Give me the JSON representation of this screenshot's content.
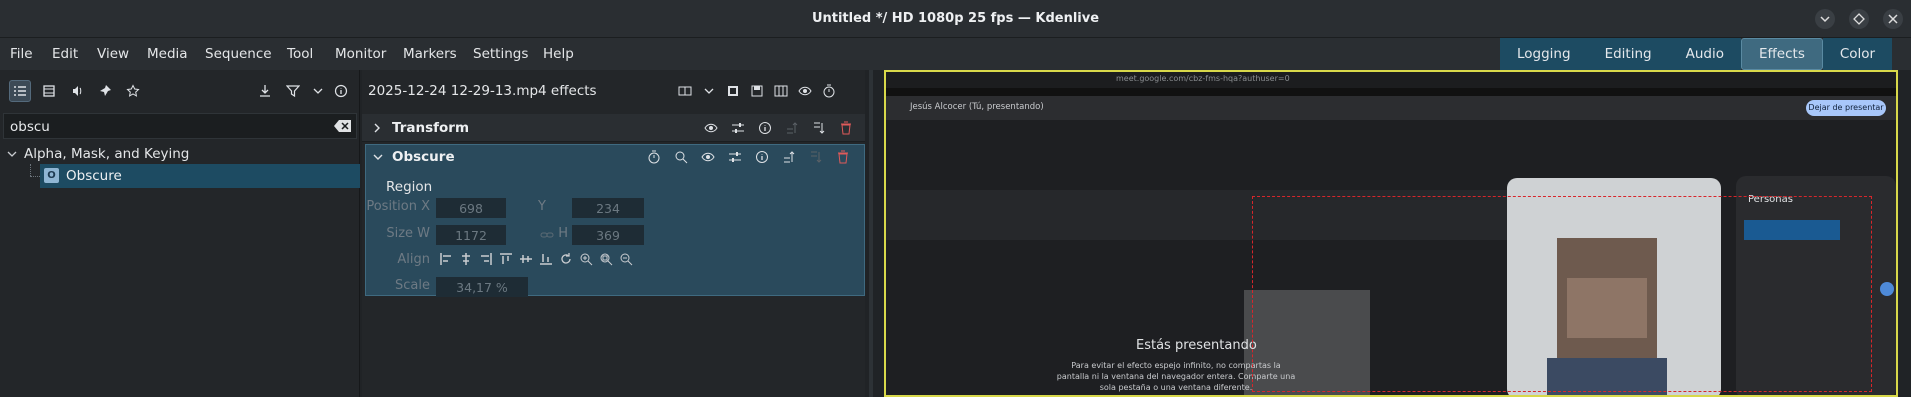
{
  "window": {
    "title": "Untitled */ HD 1080p 25 fps — Kdenlive",
    "controls": [
      "chevron-down-icon",
      "restore-icon",
      "close-icon"
    ]
  },
  "menu": {
    "items": [
      "File",
      "Edit",
      "View",
      "Media",
      "Sequence",
      "Tool",
      "Monitor",
      "Markers",
      "Settings",
      "Help"
    ]
  },
  "layouts": {
    "tabs": [
      "Logging",
      "Editing",
      "Audio",
      "Effects",
      "Color"
    ],
    "active": "Effects"
  },
  "effects_browser": {
    "search_value": "obscu",
    "category": "Alpha, Mask, and Keying",
    "item": "Obscure"
  },
  "effect_stack": {
    "title": "2025-12-24 12-29-13.mp4 effects",
    "effects": [
      {
        "name": "Transform",
        "expanded": false
      },
      {
        "name": "Obscure",
        "expanded": true
      }
    ],
    "obscure": {
      "region_label": "Region",
      "position_x_label": "Position X",
      "position_x": "698",
      "y_label": "Y",
      "y": "234",
      "size_w_label": "Size W",
      "size_w": "1172",
      "h_label": "H",
      "h": "369",
      "align_label": "Align",
      "scale_label": "Scale",
      "scale": "34,17 %"
    }
  },
  "monitor": {
    "url": "meet.google.com/cbz-fms-hqa?authuser=0",
    "presenter": "Jesús Alcocer (Tú, presentando)",
    "stop_button": "Dejar de presentar",
    "presenting": "Estás presentando",
    "subtext": "Para evitar el efecto espejo infinito, no compartas la pantalla ni la ventana del navegador entera. Comparte una sola pestaña o una ventana diferente.",
    "people_label": "Personas"
  },
  "colors": {
    "accent": "#1d4b62",
    "active_tab": "#3f6a80",
    "monitor_border": "#d8d84a",
    "obscure_region": "#d7262b"
  }
}
